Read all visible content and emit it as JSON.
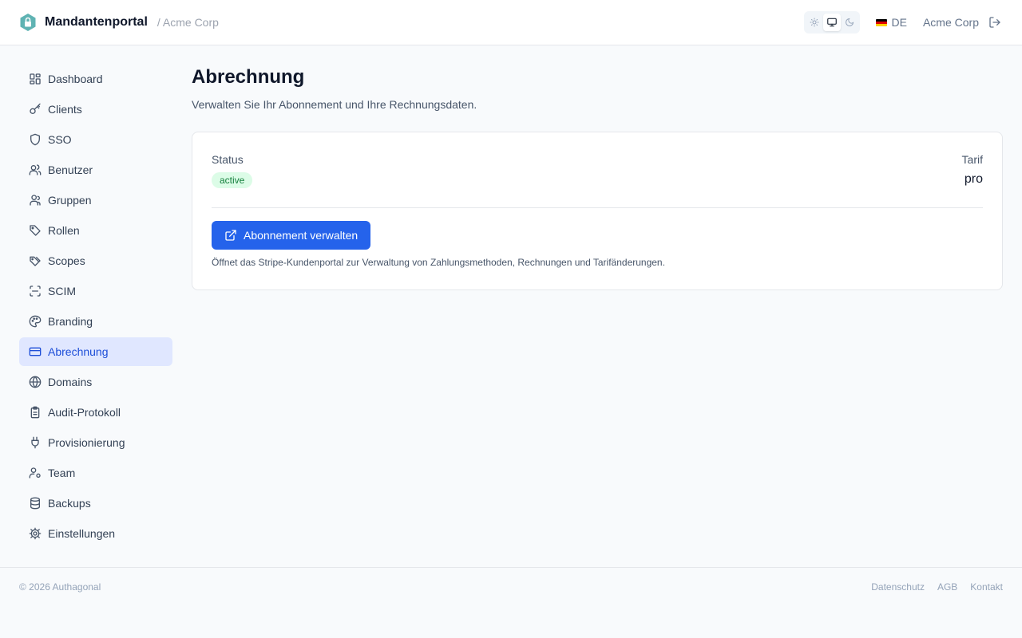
{
  "header": {
    "app_name": "Mandantenportal",
    "tenant_crumb": "/ Acme Corp",
    "theme_options": [
      "light",
      "system",
      "dark"
    ],
    "theme_selected": "system",
    "language": "DE",
    "tenant_name": "Acme Corp"
  },
  "sidebar": {
    "items": [
      {
        "label": "Dashboard",
        "icon": "dashboard-icon"
      },
      {
        "label": "Clients",
        "icon": "key-icon"
      },
      {
        "label": "SSO",
        "icon": "shield-icon"
      },
      {
        "label": "Benutzer",
        "icon": "users-icon"
      },
      {
        "label": "Gruppen",
        "icon": "group-icon"
      },
      {
        "label": "Rollen",
        "icon": "tag-icon"
      },
      {
        "label": "Scopes",
        "icon": "tags-icon"
      },
      {
        "label": "SCIM",
        "icon": "scan-icon"
      },
      {
        "label": "Branding",
        "icon": "palette-icon"
      },
      {
        "label": "Abrechnung",
        "icon": "credit-card-icon"
      },
      {
        "label": "Domains",
        "icon": "globe-icon"
      },
      {
        "label": "Audit-Protokoll",
        "icon": "clipboard-icon"
      },
      {
        "label": "Provisionierung",
        "icon": "plug-icon"
      },
      {
        "label": "Team",
        "icon": "user-cog-icon"
      },
      {
        "label": "Backups",
        "icon": "database-icon"
      },
      {
        "label": "Einstellungen",
        "icon": "gear-icon"
      }
    ],
    "active": "Abrechnung"
  },
  "main": {
    "title": "Abrechnung",
    "subtitle": "Verwalten Sie Ihr Abonnement und Ihre Rechnungsdaten.",
    "status_label": "Status",
    "status_value": "active",
    "plan_label": "Tarif",
    "plan_value": "pro",
    "manage_button": "Abonnement verwalten",
    "hint": "Öffnet das Stripe-Kundenportal zur Verwaltung von Zahlungsmethoden, Rechnungen und Tarifänderungen."
  },
  "footer": {
    "copyright": "© 2026 Authagonal",
    "links": [
      "Datenschutz",
      "AGB",
      "Kontakt"
    ]
  },
  "colors": {
    "accent": "#2563eb",
    "active_nav_bg": "#e0e7ff",
    "status_badge_bg": "#dcfce7",
    "status_badge_text": "#15803d",
    "logo": "#5fb3b3"
  }
}
